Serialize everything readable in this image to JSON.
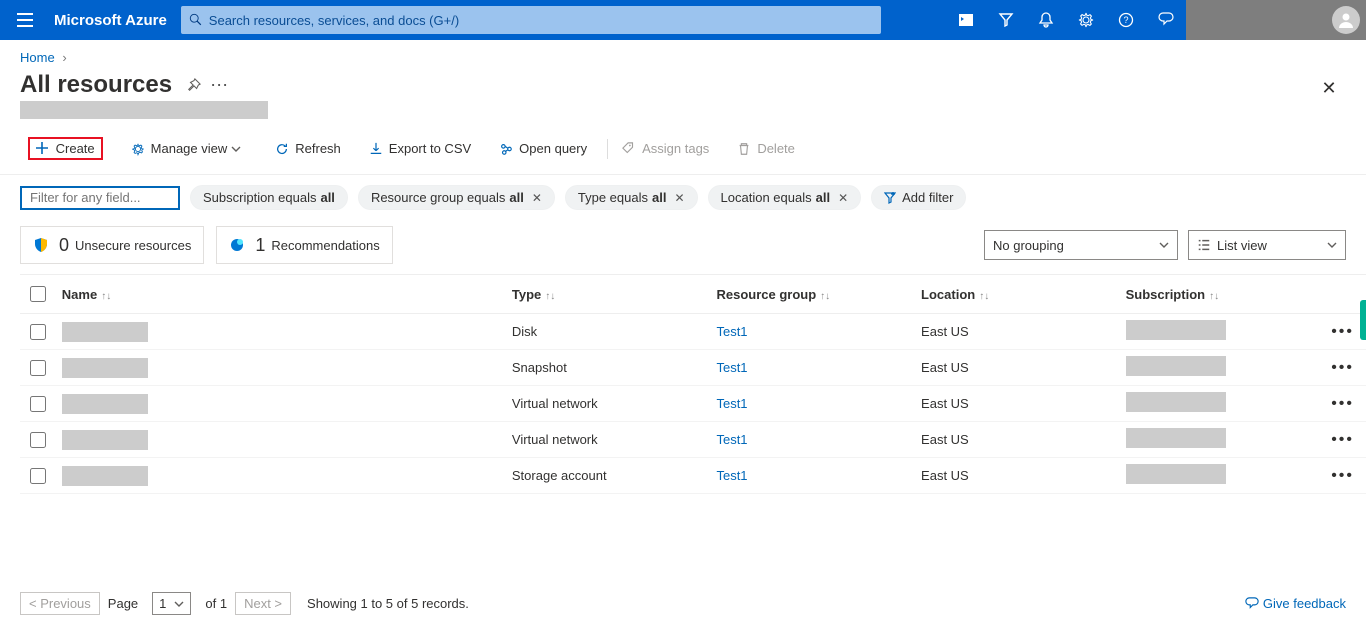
{
  "top": {
    "brand": "Microsoft Azure",
    "search_placeholder": "Search resources, services, and docs (G+/)"
  },
  "breadcrumb": {
    "home": "Home"
  },
  "title": "All resources",
  "toolbar": {
    "create": "Create",
    "manage_view": "Manage view",
    "refresh": "Refresh",
    "export_csv": "Export to CSV",
    "open_query": "Open query",
    "assign_tags": "Assign tags",
    "delete": "Delete"
  },
  "filters": {
    "field_placeholder": "Filter for any field...",
    "sub_label": "Subscription equals",
    "sub_val": "all",
    "rg_label": "Resource group equals",
    "rg_val": "all",
    "type_label": "Type equals",
    "type_val": "all",
    "loc_label": "Location equals",
    "loc_val": "all",
    "add_filter": "Add filter"
  },
  "insights": {
    "unsecure_count": "0",
    "unsecure_label": "Unsecure resources",
    "rec_count": "1",
    "rec_label": "Recommendations"
  },
  "grouping": {
    "value": "No grouping"
  },
  "listview": {
    "value": "List view"
  },
  "columns": {
    "name": "Name",
    "type": "Type",
    "rg": "Resource group",
    "loc": "Location",
    "sub": "Subscription"
  },
  "rows": [
    {
      "type": "Disk",
      "rg": "Test1",
      "loc": "East US"
    },
    {
      "type": "Snapshot",
      "rg": "Test1",
      "loc": "East US"
    },
    {
      "type": "Virtual network",
      "rg": "Test1",
      "loc": "East US"
    },
    {
      "type": "Virtual network",
      "rg": "Test1",
      "loc": "East US"
    },
    {
      "type": "Storage account",
      "rg": "Test1",
      "loc": "East US"
    }
  ],
  "pager": {
    "prev": "< Previous",
    "next": "Next >",
    "page_label": "Page",
    "page_value": "1",
    "of_label": "of 1",
    "showing": "Showing 1 to 5 of 5 records.",
    "feedback": "Give feedback"
  }
}
